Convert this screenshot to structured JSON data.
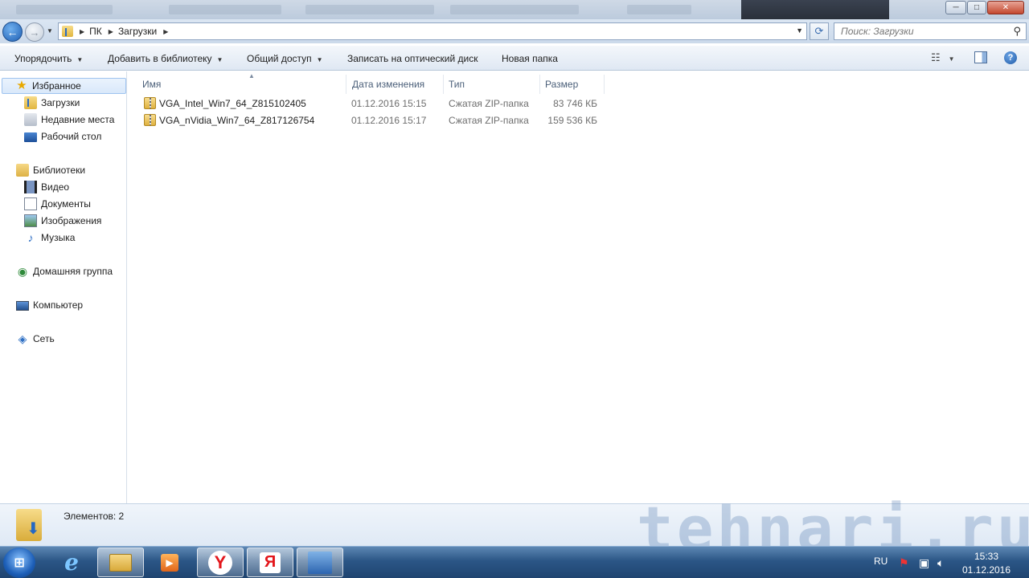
{
  "window": {
    "minimize_glyph": "─",
    "maximize_glyph": "□",
    "close_glyph": "✕"
  },
  "address_bar": {
    "breadcrumbs": [
      "ПК",
      "Загрузки"
    ],
    "search_placeholder": "Поиск: Загрузки"
  },
  "toolbar": {
    "organize_label": "Упорядочить",
    "add_to_library_label": "Добавить в библиотеку",
    "share_label": "Общий доступ",
    "burn_label": "Записать на оптический диск",
    "new_folder_label": "Новая папка"
  },
  "sidebar": {
    "favorites": {
      "label": "Избранное",
      "items": [
        "Загрузки",
        "Недавние места",
        "Рабочий стол"
      ]
    },
    "libraries": {
      "label": "Библиотеки",
      "items": [
        "Видео",
        "Документы",
        "Изображения",
        "Музыка"
      ]
    },
    "homegroup_label": "Домашняя группа",
    "computer_label": "Компьютер",
    "network_label": "Сеть"
  },
  "file_list": {
    "columns": [
      "Имя",
      "Дата изменения",
      "Тип",
      "Размер"
    ],
    "rows": [
      {
        "name": "VGA_Intel_Win7_64_Z815102405",
        "date": "01.12.2016 15:15",
        "type": "Сжатая ZIP-папка",
        "size": "83 746 КБ"
      },
      {
        "name": "VGA_nVidia_Win7_64_Z817126754",
        "date": "01.12.2016 15:17",
        "type": "Сжатая ZIP-папка",
        "size": "159 536 КБ"
      }
    ]
  },
  "details_pane": {
    "item_count": "Элементов: 2"
  },
  "watermark": "tehnari.ru",
  "taskbar": {
    "language": "RU",
    "time": "15:33",
    "date": "01.12.2016"
  }
}
